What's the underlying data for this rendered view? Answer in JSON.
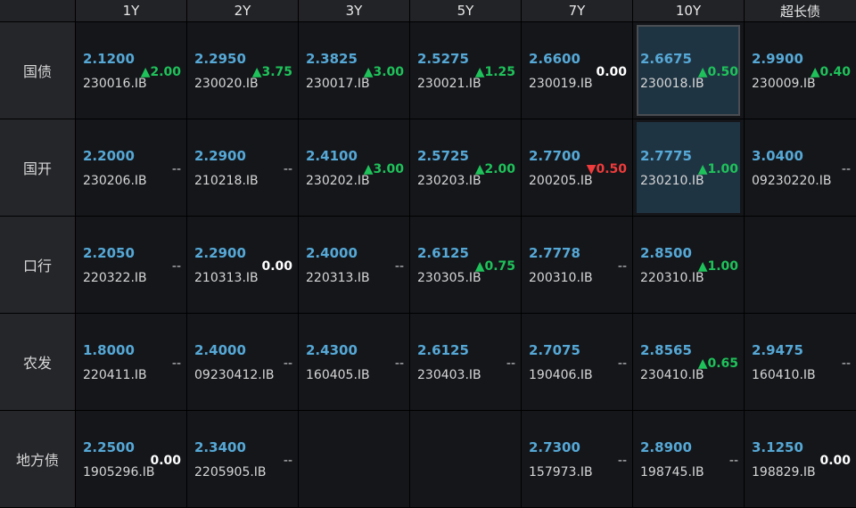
{
  "columns": [
    "1Y",
    "2Y",
    "3Y",
    "5Y",
    "7Y",
    "10Y",
    "超长债"
  ],
  "rows": [
    {
      "label": "国债",
      "cells": [
        {
          "yield": "2.1200",
          "code": "230016.IB",
          "change": "▲2.00",
          "dir": "up"
        },
        {
          "yield": "2.2950",
          "code": "230020.IB",
          "change": "▲3.75",
          "dir": "up"
        },
        {
          "yield": "2.3825",
          "code": "230017.IB",
          "change": "▲3.00",
          "dir": "up"
        },
        {
          "yield": "2.5275",
          "code": "230021.IB",
          "change": "▲1.25",
          "dir": "up"
        },
        {
          "yield": "2.6600",
          "code": "230019.IB",
          "change": "0.00",
          "dir": "zero"
        },
        {
          "yield": "2.6675",
          "code": "230018.IB",
          "change": "▲0.50",
          "dir": "up",
          "highlight": true,
          "selected": true
        },
        {
          "yield": "2.9900",
          "code": "230009.IB",
          "change": "▲0.40",
          "dir": "up"
        }
      ]
    },
    {
      "label": "国开",
      "cells": [
        {
          "yield": "2.2000",
          "code": "230206.IB",
          "change": "--",
          "dir": "none"
        },
        {
          "yield": "2.2900",
          "code": "210218.IB",
          "change": "--",
          "dir": "none"
        },
        {
          "yield": "2.4100",
          "code": "230202.IB",
          "change": "▲3.00",
          "dir": "up"
        },
        {
          "yield": "2.5725",
          "code": "230203.IB",
          "change": "▲2.00",
          "dir": "up"
        },
        {
          "yield": "2.7700",
          "code": "200205.IB",
          "change": "▼0.50",
          "dir": "down"
        },
        {
          "yield": "2.7775",
          "code": "230210.IB",
          "change": "▲1.00",
          "dir": "up",
          "highlight": true
        },
        {
          "yield": "3.0400",
          "code": "09230220.IB",
          "change": "--",
          "dir": "none"
        }
      ]
    },
    {
      "label": "口行",
      "cells": [
        {
          "yield": "2.2050",
          "code": "220322.IB",
          "change": "--",
          "dir": "none"
        },
        {
          "yield": "2.2900",
          "code": "210313.IB",
          "change": "0.00",
          "dir": "zero"
        },
        {
          "yield": "2.4000",
          "code": "220313.IB",
          "change": "--",
          "dir": "none"
        },
        {
          "yield": "2.6125",
          "code": "230305.IB",
          "change": "▲0.75",
          "dir": "up"
        },
        {
          "yield": "2.7778",
          "code": "200310.IB",
          "change": "--",
          "dir": "none"
        },
        {
          "yield": "2.8500",
          "code": "220310.IB",
          "change": "▲1.00",
          "dir": "up"
        },
        null
      ]
    },
    {
      "label": "农发",
      "cells": [
        {
          "yield": "1.8000",
          "code": "220411.IB",
          "change": "--",
          "dir": "none"
        },
        {
          "yield": "2.4000",
          "code": "09230412.IB",
          "change": "--",
          "dir": "none"
        },
        {
          "yield": "2.4300",
          "code": "160405.IB",
          "change": "--",
          "dir": "none"
        },
        {
          "yield": "2.6125",
          "code": "230403.IB",
          "change": "--",
          "dir": "none"
        },
        {
          "yield": "2.7075",
          "code": "190406.IB",
          "change": "--",
          "dir": "none"
        },
        {
          "yield": "2.8565",
          "code": "230410.IB",
          "change": "▲0.65",
          "dir": "up"
        },
        {
          "yield": "2.9475",
          "code": "160410.IB",
          "change": "--",
          "dir": "none"
        }
      ]
    },
    {
      "label": "地方债",
      "cells": [
        {
          "yield": "2.2500",
          "code": "1905296.IB",
          "change": "0.00",
          "dir": "zero"
        },
        {
          "yield": "2.3400",
          "code": "2205905.IB",
          "change": "--",
          "dir": "none"
        },
        null,
        null,
        {
          "yield": "2.7300",
          "code": "157973.IB",
          "change": "--",
          "dir": "none"
        },
        {
          "yield": "2.8900",
          "code": "198745.IB",
          "change": "--",
          "dir": "none"
        },
        {
          "yield": "3.1250",
          "code": "198829.IB",
          "change": "0.00",
          "dir": "zero"
        }
      ]
    }
  ]
}
